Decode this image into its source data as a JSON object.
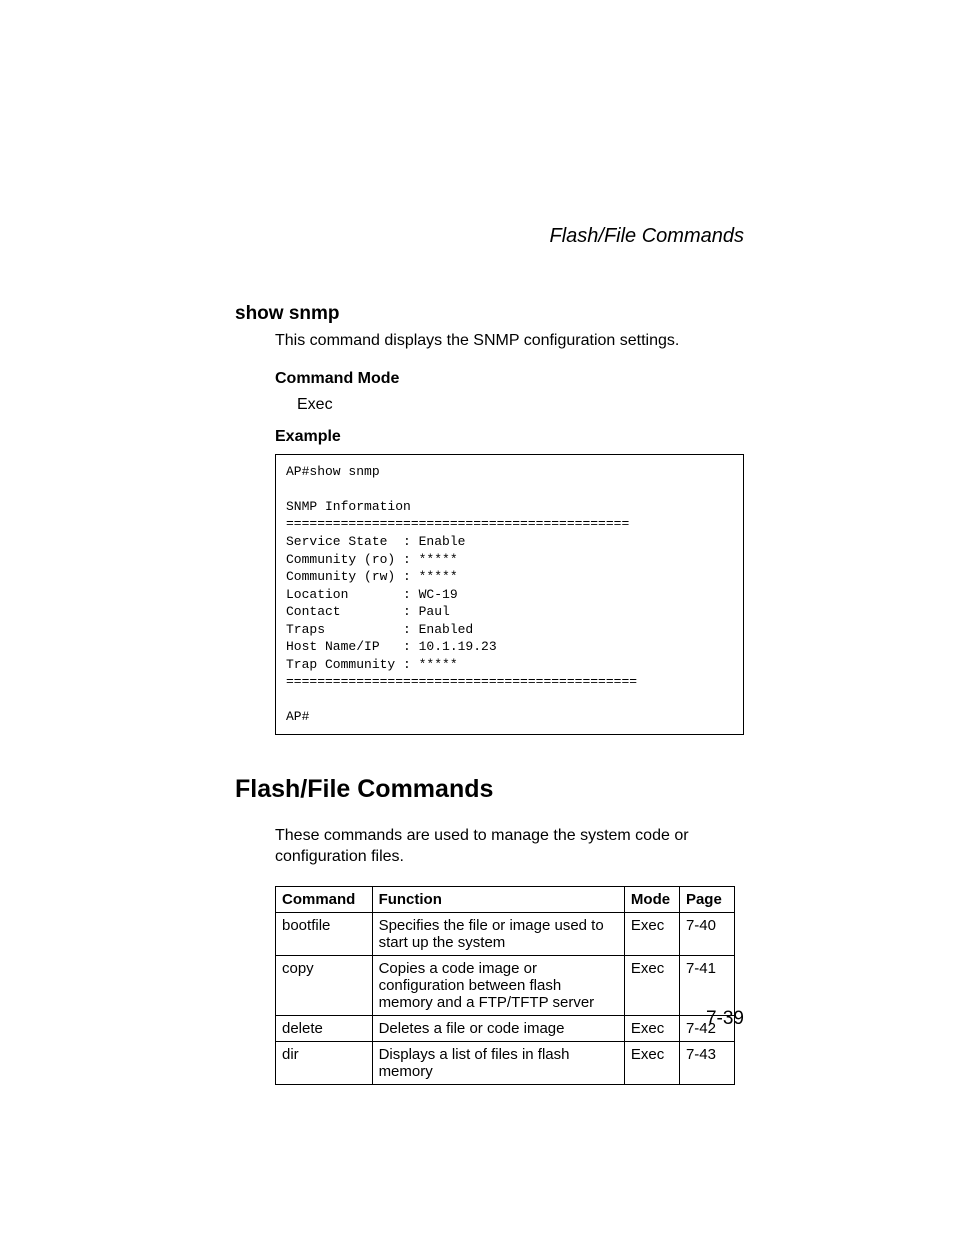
{
  "running_header": "Flash/File Commands",
  "section1": {
    "heading": "show snmp",
    "description": "This command displays the SNMP configuration settings.",
    "cmd_mode_label": "Command Mode",
    "cmd_mode_value": "Exec",
    "example_label": "Example",
    "code": "AP#show snmp\n\nSNMP Information\n============================================\nService State  : Enable\nCommunity (ro) : *****\nCommunity (rw) : *****\nLocation       : WC-19\nContact        : Paul\nTraps          : Enabled\nHost Name/IP   : 10.1.19.23\nTrap Community : *****\n=============================================\n\nAP#"
  },
  "section2": {
    "heading": "Flash/File Commands",
    "description": "These commands are used to manage the system code or configuration files."
  },
  "table": {
    "headers": {
      "command": "Command",
      "function": "Function",
      "mode": "Mode",
      "page": "Page"
    },
    "rows": [
      {
        "command": "bootfile",
        "function": "Specifies the file or image used to start up the system",
        "mode": "Exec",
        "page": "7-40"
      },
      {
        "command": "copy",
        "function": "Copies a code image or configuration between flash memory and a FTP/TFTP server",
        "mode": "Exec",
        "page": "7-41"
      },
      {
        "command": "delete",
        "function": "Deletes a file or code image",
        "mode": "Exec",
        "page": "7-42"
      },
      {
        "command": "dir",
        "function": "Displays a list of files in flash memory",
        "mode": "Exec",
        "page": "7-43"
      }
    ]
  },
  "page_number": "7-39"
}
